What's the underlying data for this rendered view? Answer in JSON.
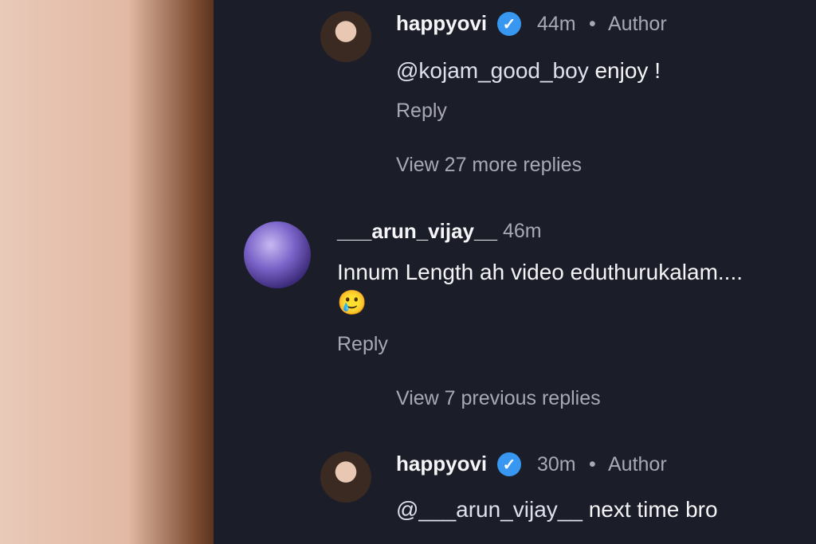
{
  "comments": [
    {
      "username": "happyovi",
      "time": "44m",
      "role": "Author",
      "mention": "@kojam_good_boy",
      "text": " enjoy !",
      "reply_label": "Reply"
    },
    {
      "username": "___arun_vijay__",
      "time": "46m",
      "text": "Innum Length ah video eduthurukalam....",
      "emoji": "🥲",
      "reply_label": "Reply"
    },
    {
      "username": "happyovi",
      "time": "30m",
      "role": "Author",
      "mention": "@___arun_vijay__",
      "text": " next time bro"
    }
  ],
  "view_more_replies": "View 27 more replies",
  "view_previous_replies": "View 7 previous replies",
  "separator": "•",
  "icons": {
    "verified": "verified-badge-icon"
  },
  "colors": {
    "background": "#1b1d29",
    "secondary_text": "#a8a9b4",
    "verified_blue": "#3897f0"
  }
}
